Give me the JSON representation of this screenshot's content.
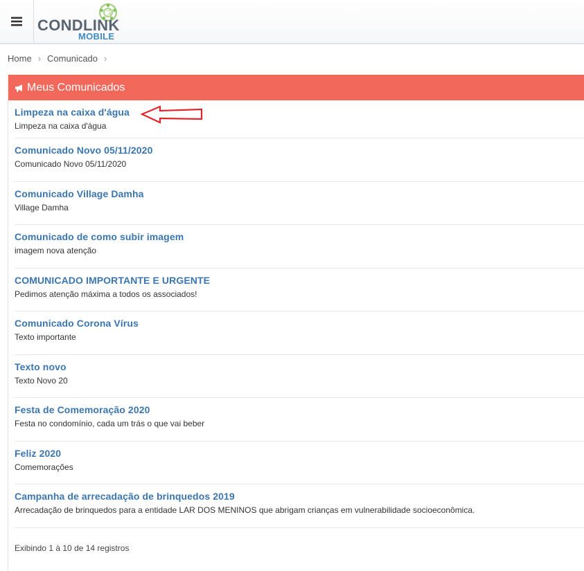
{
  "header": {
    "logo_main": "CONDLINK",
    "logo_sub": "MOBILE"
  },
  "breadcrumb": [
    {
      "label": "Home"
    },
    {
      "label": "Comunicado"
    }
  ],
  "panel": {
    "title": "Meus Comunicados",
    "header_color": "#f2685b"
  },
  "items": [
    {
      "title": "Limpeza na caixa d'água",
      "desc": "Limpeza na caixa d'água"
    },
    {
      "title": "Comunicado Novo 05/11/2020",
      "desc": "Comunicado Novo 05/11/2020"
    },
    {
      "title": "Comunicado Village Damha",
      "desc": "Village Damha"
    },
    {
      "title": "Comunicado de como subir imagem",
      "desc": "imagem nova atenção"
    },
    {
      "title": "COMUNICADO IMPORTANTE E URGENTE",
      "desc": "Pedimos atenção máxima a todos os associados!"
    },
    {
      "title": "Comunicado Corona Vírus",
      "desc": "Texto importante"
    },
    {
      "title": "Texto novo",
      "desc": "Texto Novo 20"
    },
    {
      "title": "Festa de Comemoração 2020",
      "desc": "Festa no condomínio, cada um trás o que vai beber"
    },
    {
      "title": "Feliz 2020",
      "desc": "Comemorações"
    },
    {
      "title": "Campanha de arrecadação de brinquedos 2019",
      "desc": "Arrecadação de brinquedos para a entidade LAR DOS MENINOS que abrigam crianças em vulnerabilidade socioeconômica."
    }
  ],
  "pagination": {
    "info": "Exibindo 1 à 10 de 14 registros"
  },
  "icons": {
    "menu": "hamburger-menu-icon",
    "header": "bullhorn-icon",
    "breadcrumb_separator": "chevron-right-icon",
    "annotation": "red-arrow-annotation"
  }
}
